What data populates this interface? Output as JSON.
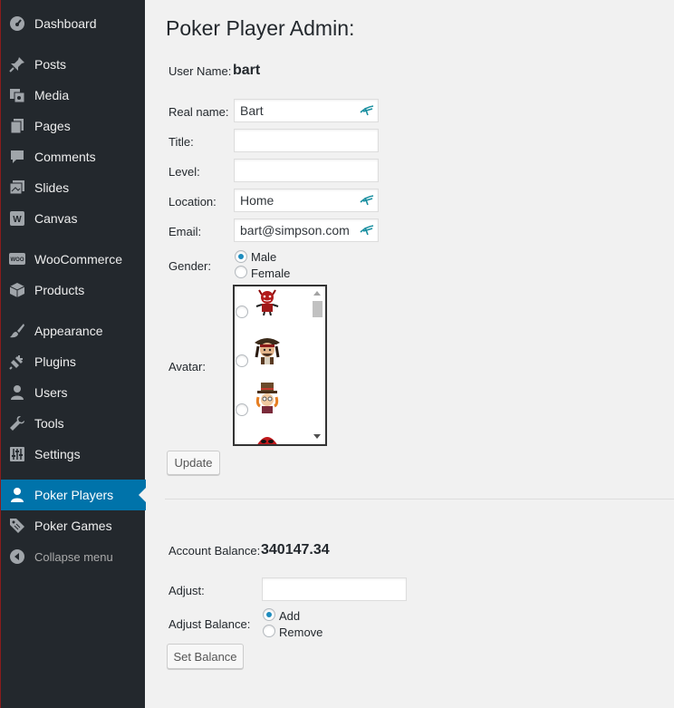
{
  "sidebar": {
    "items": [
      {
        "label": "Dashboard",
        "icon": "dashboard-icon"
      },
      {
        "label": "Posts",
        "icon": "pin-icon"
      },
      {
        "label": "Media",
        "icon": "media-icon"
      },
      {
        "label": "Pages",
        "icon": "pages-icon"
      },
      {
        "label": "Comments",
        "icon": "comment-icon"
      },
      {
        "label": "Slides",
        "icon": "slides-icon"
      },
      {
        "label": "Canvas",
        "icon": "canvas-icon"
      },
      {
        "label": "WooCommerce",
        "icon": "woo-icon"
      },
      {
        "label": "Products",
        "icon": "box-icon"
      },
      {
        "label": "Appearance",
        "icon": "brush-icon"
      },
      {
        "label": "Plugins",
        "icon": "plug-icon"
      },
      {
        "label": "Users",
        "icon": "user-icon"
      },
      {
        "label": "Tools",
        "icon": "wrench-icon"
      },
      {
        "label": "Settings",
        "icon": "sliders-icon"
      },
      {
        "label": "Poker Players",
        "icon": "user-icon",
        "active": true
      },
      {
        "label": "Poker Games",
        "icon": "tag-icon"
      },
      {
        "label": "Collapse menu",
        "icon": "collapse-icon"
      }
    ],
    "bg_color": "#23282d",
    "active_color": "#0073aa"
  },
  "page": {
    "title": "Poker Player Admin:"
  },
  "profile": {
    "username_label": "User Name:",
    "username": "bart",
    "realname_label": "Real name:",
    "realname": "Bart",
    "title_label": "Title:",
    "title": "",
    "level_label": "Level:",
    "level": "",
    "location_label": "Location:",
    "location": "Home",
    "email_label": "Email:",
    "email": "bart@simpson.com",
    "gender_label": "Gender:",
    "gender_options": [
      "Male",
      "Female"
    ],
    "gender_selected": "Male",
    "avatar_label": "Avatar:",
    "update_label": "Update"
  },
  "balance": {
    "account_label": "Account Balance:",
    "account_value": "340147.34",
    "adjust_label": "Adjust:",
    "adjust_value": "",
    "adjust_balance_label": "Adjust Balance:",
    "options": [
      "Add",
      "Remove"
    ],
    "selected": "Add",
    "set_label": "Set Balance"
  }
}
